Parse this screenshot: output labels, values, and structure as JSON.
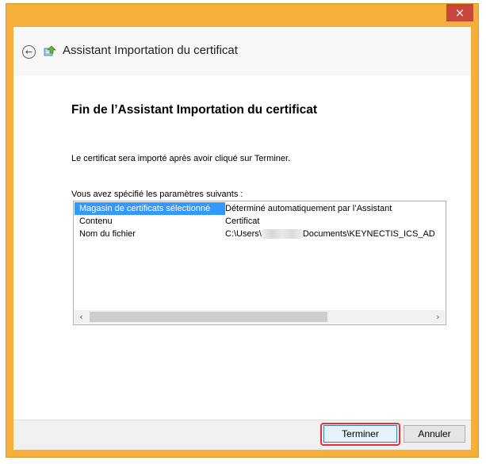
{
  "window": {
    "title": "Assistant Importation du certificat",
    "close_glyph": "×",
    "close_icon": "close-icon"
  },
  "header": {
    "back_icon": "back-arrow-icon",
    "back_glyph": "←",
    "wizard_icon": "certificate-wizard-icon"
  },
  "main": {
    "heading": "Fin de l’Assistant Importation du certificat",
    "info_text": "Le certificat sera importé après avoir cliqué sur Terminer.",
    "params_label": "Vous avez spécifié les paramètres suivants :",
    "settings": [
      {
        "name": "Magasin de certificats sélectionné",
        "value": "Déterminé automatiquement par l’Assistant"
      },
      {
        "name": "Contenu",
        "value": "Certificat"
      },
      {
        "name": "Nom du fichier",
        "value_prefix": "C:\\Users\\",
        "value_suffix": "Documents\\KEYNECTIS_ICS_AD"
      }
    ],
    "scroll_left": "‹",
    "scroll_right": "›"
  },
  "footer": {
    "finish_label": "Terminer",
    "cancel_label": "Annuler"
  },
  "colors": {
    "window_frame": "#f4b03b",
    "close_button": "#c7473a",
    "selection": "#3399ff",
    "highlight": "#e0333e"
  }
}
